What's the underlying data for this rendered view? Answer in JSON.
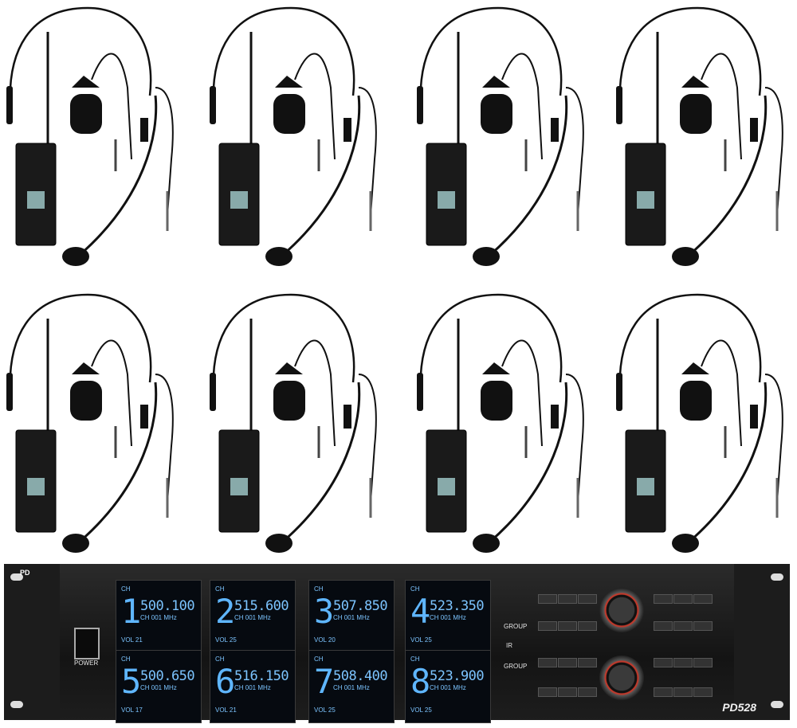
{
  "kits": [
    {
      "id": "kit-1"
    },
    {
      "id": "kit-2"
    },
    {
      "id": "kit-3"
    },
    {
      "id": "kit-4"
    },
    {
      "id": "kit-5"
    },
    {
      "id": "kit-6"
    },
    {
      "id": "kit-7"
    },
    {
      "id": "kit-8"
    }
  ],
  "receiver": {
    "brand": "PD",
    "power_label": "POWER",
    "model": "PD528",
    "channels": [
      {
        "num": "1",
        "freq": "500.100",
        "vol": "VOL 21"
      },
      {
        "num": "2",
        "freq": "515.600",
        "vol": "VOL 25"
      },
      {
        "num": "3",
        "freq": "507.850",
        "vol": "VOL 20"
      },
      {
        "num": "4",
        "freq": "523.350",
        "vol": "VOL 25"
      },
      {
        "num": "5",
        "freq": "500.650",
        "vol": "VOL 17"
      },
      {
        "num": "6",
        "freq": "516.150",
        "vol": "VOL 21"
      },
      {
        "num": "7",
        "freq": "508.400",
        "vol": "VOL 25"
      },
      {
        "num": "8",
        "freq": "523.900",
        "vol": "VOL 25"
      }
    ],
    "display_ch": "CH",
    "display_sub": "CH 001  MHz",
    "group_label": "GROUP",
    "ir_label": "IR"
  }
}
